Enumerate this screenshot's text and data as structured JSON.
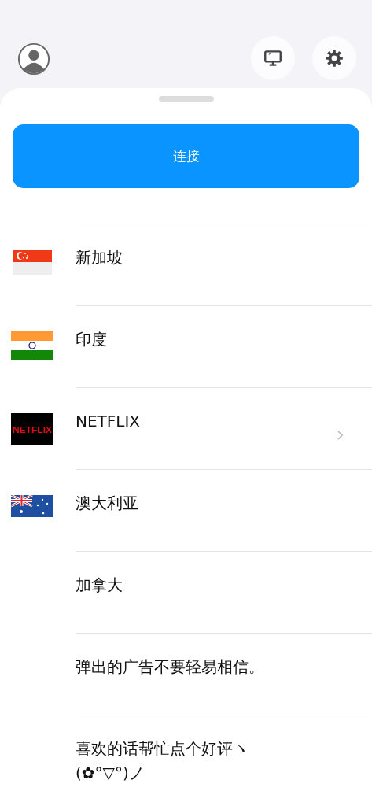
{
  "header": {
    "buttons": [
      {
        "kind": "monitor"
      },
      {
        "kind": "settings"
      }
    ]
  },
  "connect_button": {
    "label": "连接"
  },
  "list": [
    {
      "label": "新加坡",
      "kind": "singapore",
      "chevron": false
    },
    {
      "label": "印度",
      "kind": "india",
      "chevron": false
    },
    {
      "label": "NETFLIX",
      "kind": "netflix",
      "logo_text": "NETFLIX",
      "chevron": true
    },
    {
      "label": "澳大利亚",
      "kind": "australia",
      "chevron": false
    },
    {
      "label": "加拿大",
      "chevron": false
    },
    {
      "label": "弹出的广告不要轻易相信。",
      "chevron": false
    },
    {
      "label": "喜欢的话帮忙点个好评ヽ(✿°▽°)ノ",
      "chevron": false
    }
  ]
}
